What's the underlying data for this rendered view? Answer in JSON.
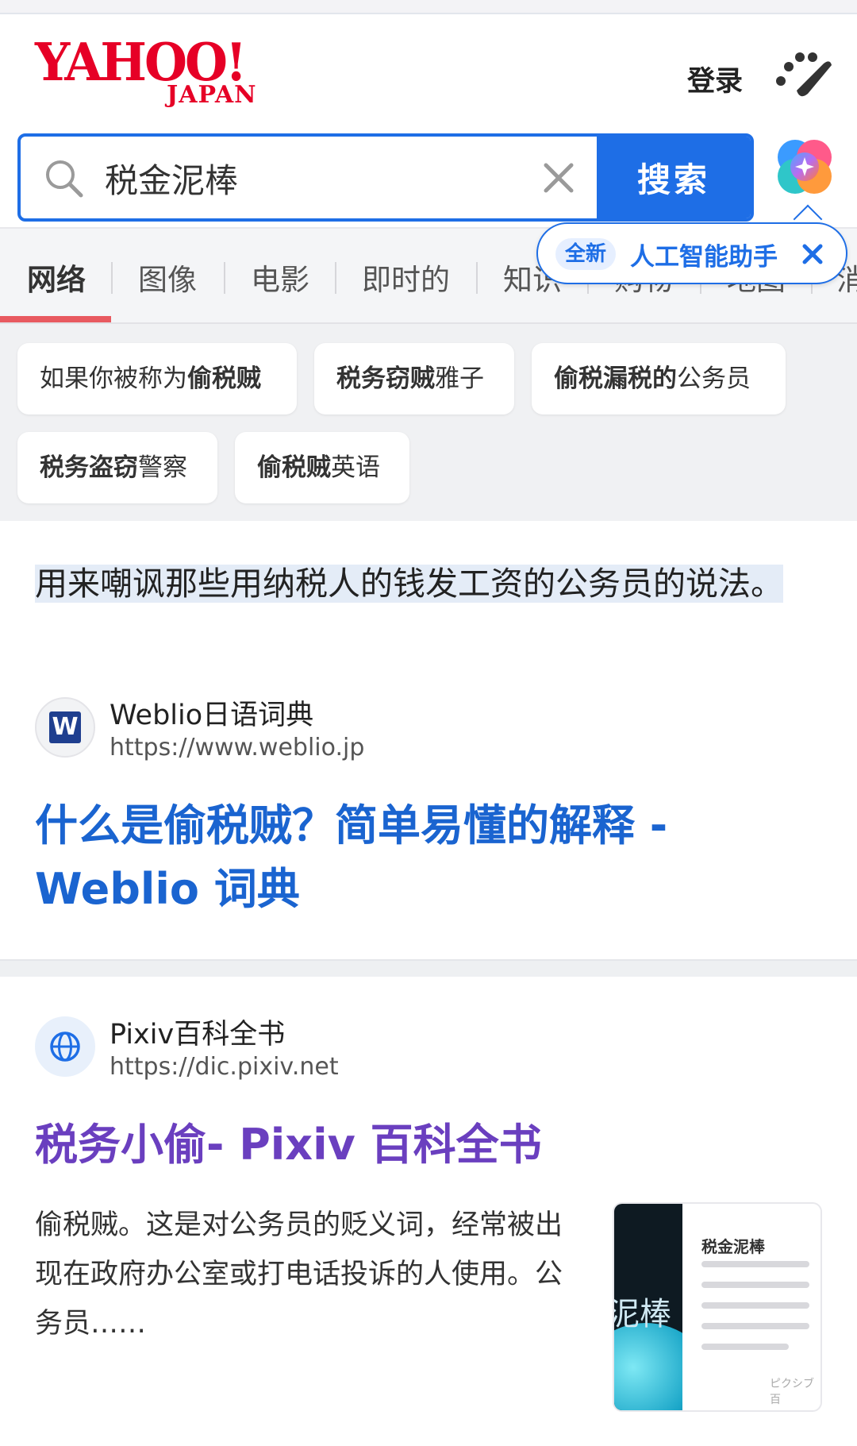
{
  "header": {
    "logo_main": "YAHOO!",
    "logo_sub": "JAPAN",
    "login_label": "登录"
  },
  "search": {
    "query": "税金泥棒",
    "button_label": "搜索"
  },
  "tabs": [
    {
      "label": "网络",
      "active": true
    },
    {
      "label": "图像"
    },
    {
      "label": "电影"
    },
    {
      "label": "即时的"
    },
    {
      "label": "知识"
    },
    {
      "label": "购物"
    },
    {
      "label": "地图"
    },
    {
      "label": "消"
    }
  ],
  "ai_tip": {
    "badge": "全新",
    "label": "人工智能助手"
  },
  "suggestions": [
    {
      "plain": "如果你被称为",
      "bold": "偷税贼",
      "bold_first": false
    },
    {
      "bold": "税务窃贼",
      "plain": "雅子",
      "bold_first": true
    },
    {
      "bold": "偷税漏税的",
      "plain": "公务员",
      "bold_first": true
    },
    {
      "bold": "税务盗窃",
      "plain": "警察",
      "bold_first": true
    },
    {
      "bold": "偷税贼",
      "plain": "英语",
      "bold_first": true
    }
  ],
  "results": [
    {
      "snippet": "用来嘲讽那些用纳税人的钱发工资的公务员的说法。",
      "site_name": "Weblio日语词典",
      "site_url": "https://www.weblio.jp",
      "site_logo_letter": "W",
      "title": "什么是偷税贼？简单易懂的解释 - Weblio 词典"
    },
    {
      "site_name": "Pixiv百科全书",
      "site_url": "https://dic.pixiv.net",
      "title": "税务小偷- Pixiv 百科全书",
      "description": "偷税贼。这是对公务员的贬义词，经常被出现在政府办公室或打电话投诉的人使用。公务员……",
      "thumb": {
        "big_text": "泥棒",
        "title": "税金泥棒",
        "footer": "ピクシブ百"
      }
    }
  ],
  "colors": {
    "brand_red": "#e60026",
    "accent_blue": "#1e6ee6",
    "visited_purple": "#6a3fbf",
    "tab_underline": "#e85a60"
  }
}
